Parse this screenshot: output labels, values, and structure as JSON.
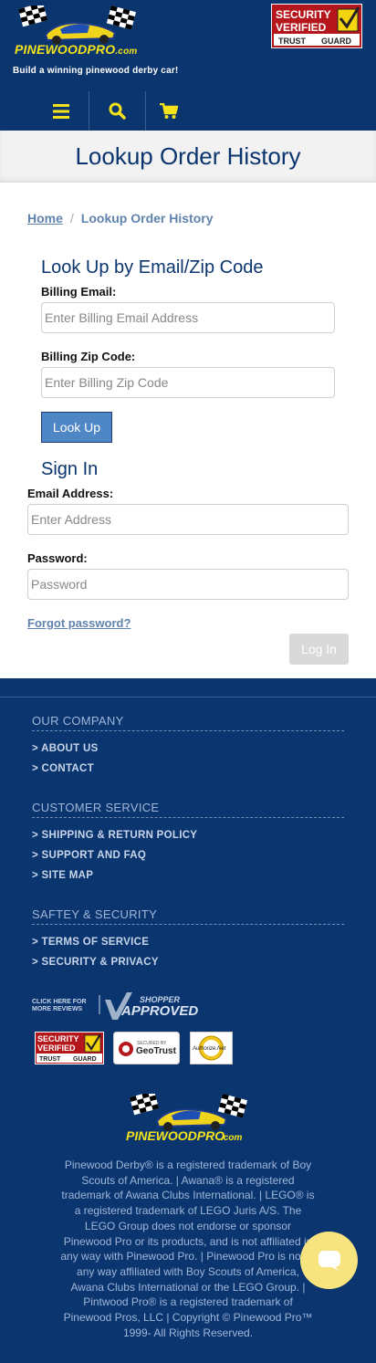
{
  "header": {
    "brand_name": "PINEWOODPRO",
    "brand_suffix": ".com",
    "tagline": "Build a winning pinewood derby car!",
    "trust_badge": {
      "line1": "SECURITY",
      "line2": "VERIFIED",
      "line3": "TRUST",
      "line4": "GUARD"
    },
    "nav": {
      "menu_icon": "menu-icon",
      "search_icon": "search-icon",
      "cart_icon": "cart-icon"
    }
  },
  "page_title": "Lookup Order History",
  "breadcrumb": {
    "home": "Home",
    "separator": "/",
    "current": "Lookup Order History"
  },
  "lookup": {
    "heading": "Look Up by Email/Zip Code",
    "email_label": "Billing Email:",
    "email_placeholder": "Enter Billing Email Address",
    "email_value": "",
    "zip_label": "Billing Zip Code:",
    "zip_placeholder": "Enter Billing Zip Code",
    "zip_value": "",
    "button": "Look Up"
  },
  "signin": {
    "heading": "Sign In",
    "email_label": "Email Address:",
    "email_placeholder": "Enter Address",
    "email_value": "",
    "password_label": "Password:",
    "password_placeholder": "Password",
    "password_value": "",
    "forgot": "Forgot password?",
    "button": "Log In"
  },
  "footer": {
    "sections": [
      {
        "title": "OUR COMPANY",
        "links": [
          "> ABOUT US",
          "> CONTACT"
        ]
      },
      {
        "title": "CUSTOMER SERVICE",
        "links": [
          "> SHIPPING & RETURN POLICY",
          "> SUPPORT AND FAQ",
          "> SITE MAP"
        ]
      },
      {
        "title": "SAFTEY & SECURITY",
        "links": [
          "> TERMS OF SERVICE",
          "> SECURITY & PRIVACY"
        ]
      }
    ],
    "shopper": {
      "click_text_1": "CLICK HERE FOR",
      "click_text_2": "MORE REVIEWS",
      "shopper_word": "SHOPPER",
      "approved_word": "APPROVED"
    },
    "badges": {
      "trust_1": "SECURITY",
      "trust_2": "VERIFIED",
      "trust_3": "TRUST",
      "trust_4": "GUARD",
      "geotrust_small": "SECURED BY",
      "geotrust": "GeoTrust",
      "authorize": "Authorize.Net"
    },
    "disclaimer": "Pinewood Derby® is a registered trademark of Boy Scouts of America. | Awana® is a registered trademark of Awana Clubs International. | LEGO® is a registered trademark of LEGO Juris A/S. The LEGO Group does not endorse or sponsor Pinewood Pro or its products, and is not affiliated in any way with Pinewood Pro. | Pinewood Pro is not in any way affiliated with Boy Scouts of America, Awana Clubs International or the LEGO Group. | Pintwood Pro® is a registered trademark of Pinewood Pros, LLC | Copyright © Pinewood Pro™ 1999- All Rights Reserved."
  },
  "chat": {
    "icon": "chat-bubble-icon"
  },
  "colors": {
    "brand_blue": "#0b356f",
    "brand_yellow": "#f5e31a",
    "link_blue": "#5f83ad",
    "button_blue": "#4f86c6",
    "chat_yellow": "#f7e47f"
  }
}
